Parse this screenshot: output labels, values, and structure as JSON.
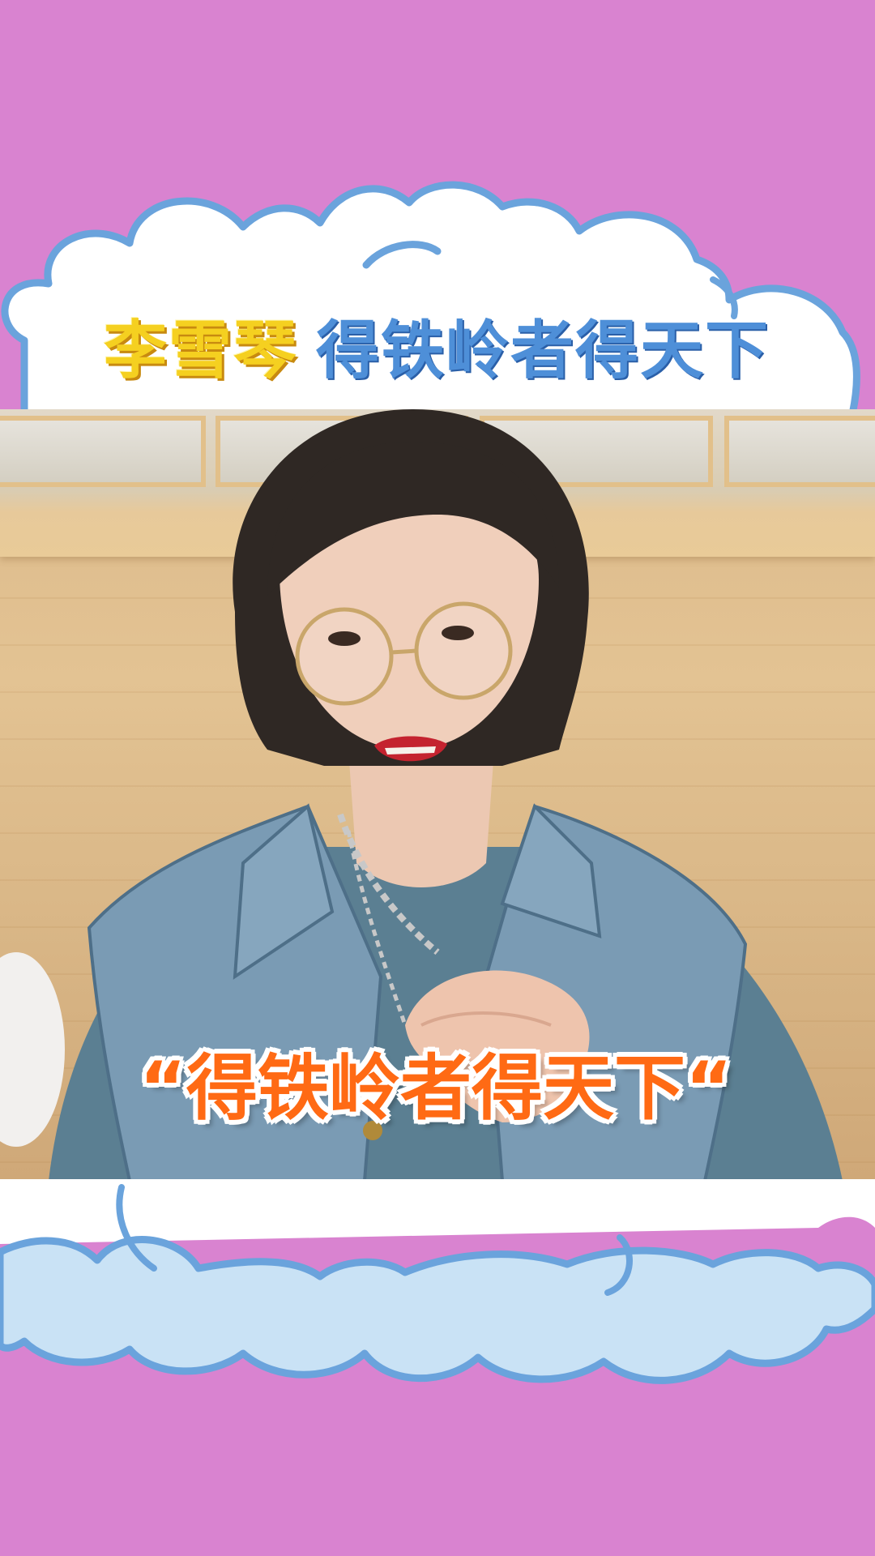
{
  "overlay": {
    "title_name": "李雪琴",
    "title_slogan": "得铁岭者得天下",
    "caption": "“得铁岭者得天下“"
  },
  "colors": {
    "background": "#d983d0",
    "cloud_outline": "#6aa3dc",
    "cloud_fill_light": "#ffffff",
    "cloud_fill_blue": "#c9e2f5",
    "title_name": "#f5d020",
    "title_slogan": "#4e8fd8",
    "caption": "#ff6a14"
  }
}
